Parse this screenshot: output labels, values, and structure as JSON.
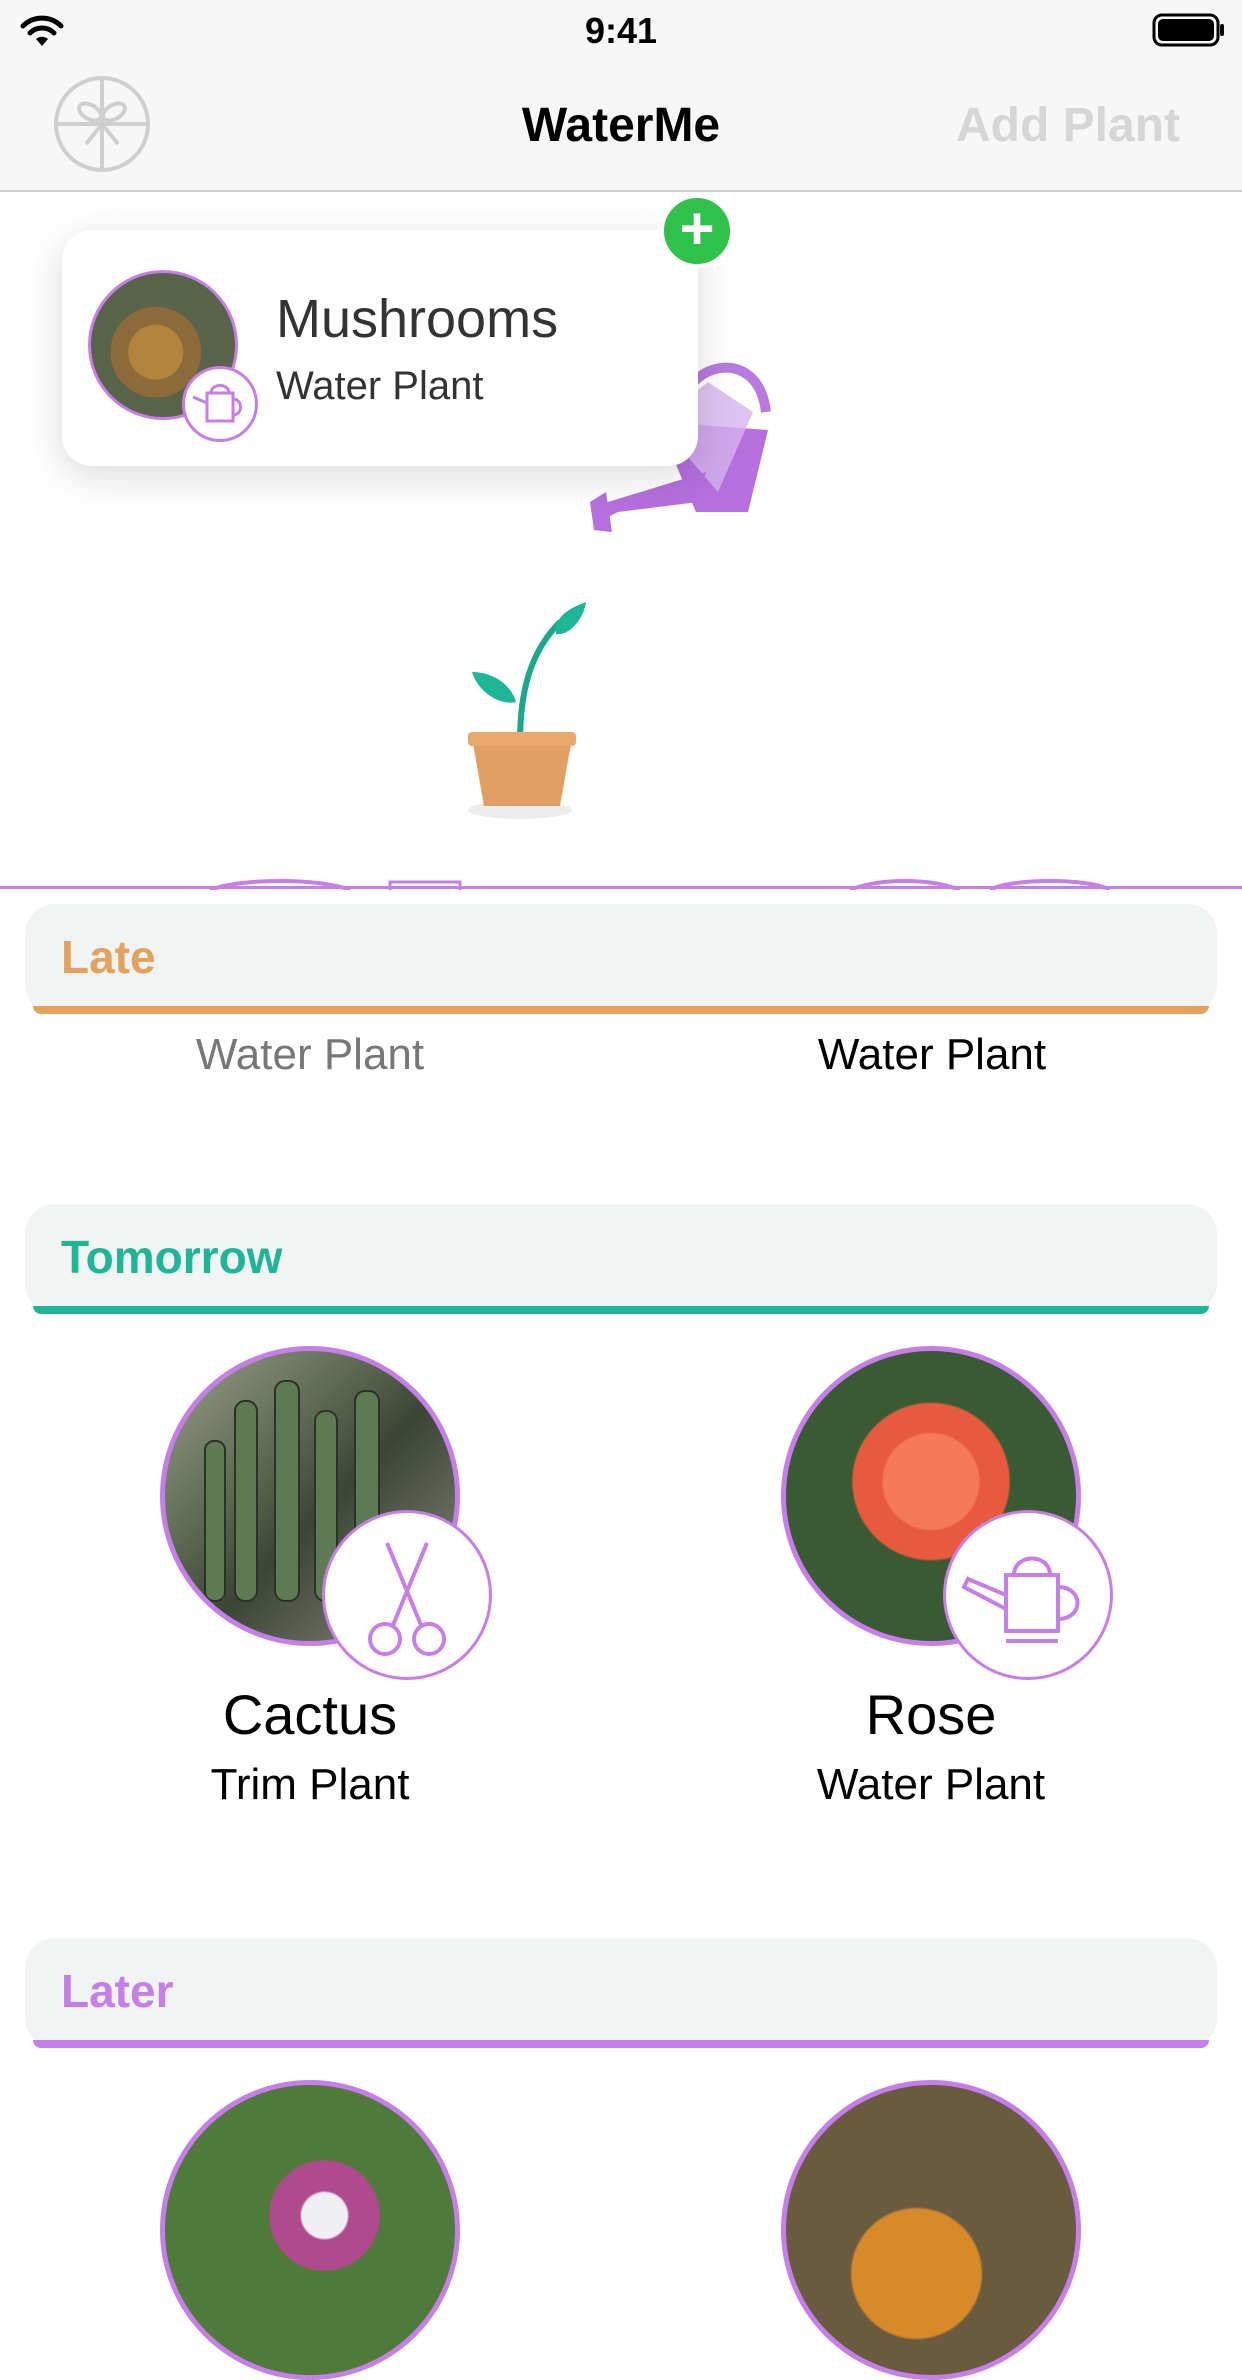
{
  "status_bar": {
    "time": "9:41",
    "wifi_icon": "wifi-icon",
    "battery_icon": "battery-icon"
  },
  "nav": {
    "title": "WaterMe",
    "add_plant_label": "Add Plant",
    "left_icon": "gift-icon"
  },
  "drag_card": {
    "name": "Mushrooms",
    "action": "Water Plant",
    "add_icon": "plus-icon",
    "badge_icon": "watering-can-icon"
  },
  "colors": {
    "accent_purple": "#c67ee8",
    "late_orange": "#e4a25c",
    "tomorrow_teal": "#1fb597",
    "later_purple": "#c67ee8",
    "add_green": "#30c14d"
  },
  "sections": {
    "late": {
      "title": "Late",
      "items": [
        {
          "action": "Water Plant"
        },
        {
          "action": "Water Plant"
        }
      ]
    },
    "tomorrow": {
      "title": "Tomorrow",
      "items": [
        {
          "name": "Cactus",
          "action": "Trim Plant",
          "badge_icon": "scissors-icon"
        },
        {
          "name": "Rose",
          "action": "Water Plant",
          "badge_icon": "watering-can-icon"
        }
      ]
    },
    "later": {
      "title": "Later"
    }
  }
}
